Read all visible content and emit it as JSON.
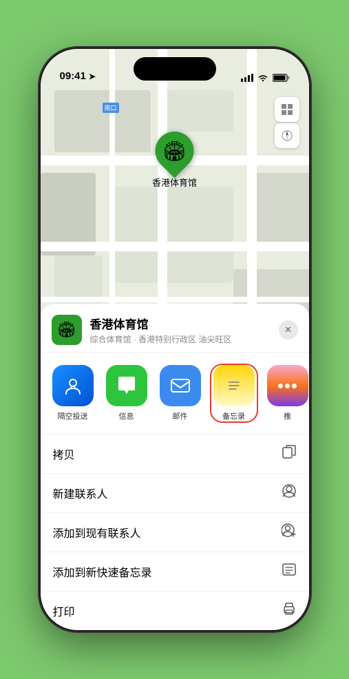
{
  "status_bar": {
    "time": "09:41",
    "location_arrow": "▶"
  },
  "map": {
    "label_badge": "南口",
    "stadium_label": "香港体育馆"
  },
  "sheet": {
    "venue_name": "香港体育馆",
    "venue_subtitle": "综合体育馆 · 香港特别行政区 油尖旺区",
    "close_label": "✕"
  },
  "share_items": [
    {
      "id": "airdrop",
      "label": "隔空投送",
      "type": "airdrop"
    },
    {
      "id": "messages",
      "label": "信息",
      "type": "messages"
    },
    {
      "id": "mail",
      "label": "邮件",
      "type": "mail"
    },
    {
      "id": "notes",
      "label": "备忘录",
      "type": "notes"
    }
  ],
  "actions": [
    {
      "id": "copy",
      "label": "拷贝",
      "icon": "copy"
    },
    {
      "id": "new-contact",
      "label": "新建联系人",
      "icon": "person"
    },
    {
      "id": "add-existing",
      "label": "添加到现有联系人",
      "icon": "person-add"
    },
    {
      "id": "add-note",
      "label": "添加到新快速备忘录",
      "icon": "note"
    },
    {
      "id": "print",
      "label": "打印",
      "icon": "printer"
    }
  ],
  "icons": {
    "copy": "⎘",
    "person": "👤",
    "person-add": "👤",
    "note": "🗒",
    "printer": "🖨"
  }
}
